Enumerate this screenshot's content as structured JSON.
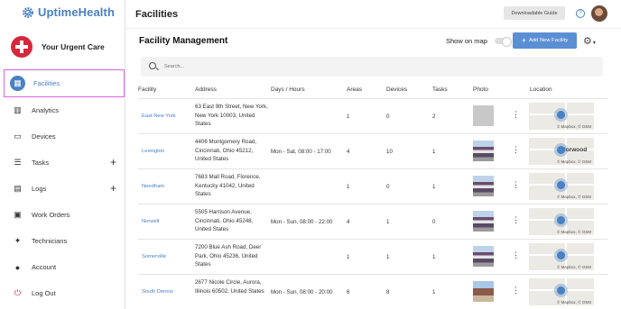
{
  "app": {
    "name": "UptimeHealth",
    "org": "Your Urgent Care"
  },
  "sidebar": {
    "items": [
      {
        "label": "Facilities",
        "icon": "building-icon",
        "active": true
      },
      {
        "label": "Analytics",
        "icon": "chart-icon"
      },
      {
        "label": "Devices",
        "icon": "devices-icon"
      },
      {
        "label": "Tasks",
        "icon": "list-icon",
        "plus": "+"
      },
      {
        "label": "Logs",
        "icon": "log-icon",
        "plus": "+"
      },
      {
        "label": "Work Orders",
        "icon": "clipboard-icon"
      },
      {
        "label": "Technicians",
        "icon": "wrench-icon"
      },
      {
        "label": "Account",
        "icon": "user-icon"
      },
      {
        "label": "Log Out",
        "icon": "power-icon"
      }
    ]
  },
  "header": {
    "title": "Facilities",
    "guide_label": "Downloadable Guide",
    "help": "?"
  },
  "main": {
    "section_title": "Facility Management",
    "show_map_label": "Show on map",
    "add_label": "Add New Facility",
    "add_plus": "+",
    "settings_icon": "⚙",
    "settings_caret": "▾",
    "search_placeholder": "Search...",
    "columns": {
      "facility": "Facility",
      "address": "Address",
      "days": "Days / Hours",
      "areas": "Areas",
      "devices": "Devices",
      "tasks": "Tasks",
      "photo": "Photo",
      "location": "Location"
    },
    "rows": [
      {
        "facility": "East New York",
        "address": "63 East 9th Street, New York, New York 10003, United States",
        "days": "",
        "areas": "1",
        "devices": "0",
        "tasks": "2",
        "photo": "placeholder",
        "map_credit": "© Mapbox, © OSM",
        "map_label": ""
      },
      {
        "facility": "Lexington",
        "address": "4406 Montgomery Road, Cincinnati, Ohio 45212, United States",
        "days": "Mon - Sat, 08:00 - 17:00",
        "areas": "4",
        "devices": "10",
        "tasks": "1",
        "photo": "building",
        "map_credit": "© Mapbox, © OSM",
        "map_label": "Norwood"
      },
      {
        "facility": "Needham",
        "address": "7683 Mall Road, Florence, Kentucky 41042, United States",
        "days": "",
        "areas": "1",
        "devices": "0",
        "tasks": "1",
        "photo": "building",
        "map_credit": "© Mapbox, © OSM",
        "map_label": ""
      },
      {
        "facility": "Norwell",
        "address": "5505 Harrison Avenue, Cincinnati, Ohio 45248, United States",
        "days": "Mon - Sun, 08:00 - 22:00",
        "areas": "4",
        "devices": "1",
        "tasks": "0",
        "photo": "building",
        "map_credit": "© Mapbox, © OSM",
        "map_label": ""
      },
      {
        "facility": "Somerville",
        "address": "7200 Blue Ash Road, Deer Park, Ohio 45236, United States",
        "days": "",
        "areas": "1",
        "devices": "1",
        "tasks": "1",
        "photo": "building",
        "map_credit": "© Mapbox, © OSM",
        "map_label": ""
      },
      {
        "facility": "South Dennis",
        "address": "2677 Nicole Circle, Aurora, Illinois 60502, United States",
        "days": "Mon - Sun, 08:00 - 20:00",
        "areas": "6",
        "devices": "8",
        "tasks": "1",
        "photo": "house",
        "map_credit": "© Mapbox, © OSM",
        "map_label": ""
      }
    ],
    "row_menu": "⋮"
  },
  "colors": {
    "accent": "#4a80c4",
    "button": "#5b8fd4",
    "highlight": "#d966e0",
    "brand_red": "#d6283a"
  }
}
